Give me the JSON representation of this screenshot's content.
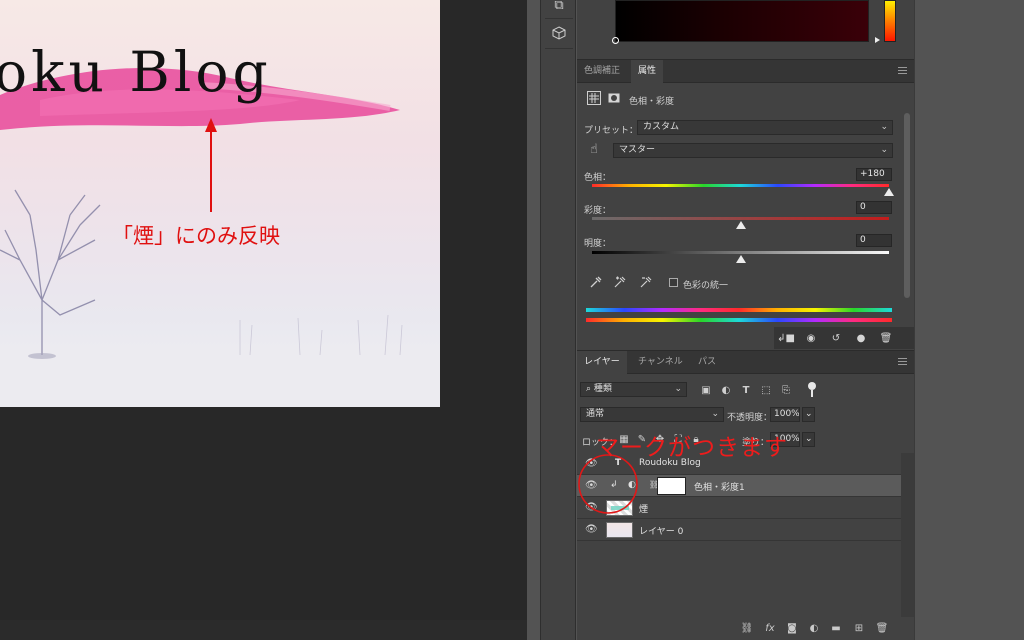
{
  "canvas": {
    "doc_title": "oku Blog",
    "annotation_text": "「煙」にのみ反映",
    "colors": {
      "annotation": "#e01010",
      "brush_pink": "#e8489a"
    }
  },
  "tools": {
    "icons": [
      "channel-swap-icon",
      "3d-cube-icon"
    ]
  },
  "properties_panel": {
    "tabs": [
      {
        "label": "色調補正",
        "active": false
      },
      {
        "label": "属性",
        "active": true
      }
    ],
    "adjustment_title": "色相・彩度",
    "preset_label": "プリセット：",
    "preset_value": "カスタム",
    "channel_value": "マスター",
    "hue": {
      "label": "色相：",
      "value": "+180",
      "level": 1.0
    },
    "saturation": {
      "label": "彩度：",
      "value": "0",
      "level": 0.5
    },
    "lightness": {
      "label": "明度：",
      "value": "0",
      "level": 0.5
    },
    "colorize_label": "色彩の統一",
    "colorize_checked": false
  },
  "layers_panel": {
    "tabs": [
      {
        "label": "レイヤー",
        "active": true
      },
      {
        "label": "チャンネル",
        "active": false
      },
      {
        "label": "パス",
        "active": false
      }
    ],
    "filter_value": "種類",
    "blend_mode": "通常",
    "opacity_label": "不透明度：",
    "opacity_value": "100%",
    "lock_label": "ロック：",
    "fill_label": "塗り：",
    "fill_value": "100%",
    "layers": [
      {
        "name": "Roudoku Blog",
        "type": "text",
        "selected": false
      },
      {
        "name": "色相・彩度1",
        "type": "adjustment",
        "selected": true
      },
      {
        "name": "煙",
        "type": "pixel",
        "selected": false
      },
      {
        "name": "レイヤー 0",
        "type": "pixel",
        "selected": false
      }
    ],
    "annotation_text": "マークがつきます"
  }
}
